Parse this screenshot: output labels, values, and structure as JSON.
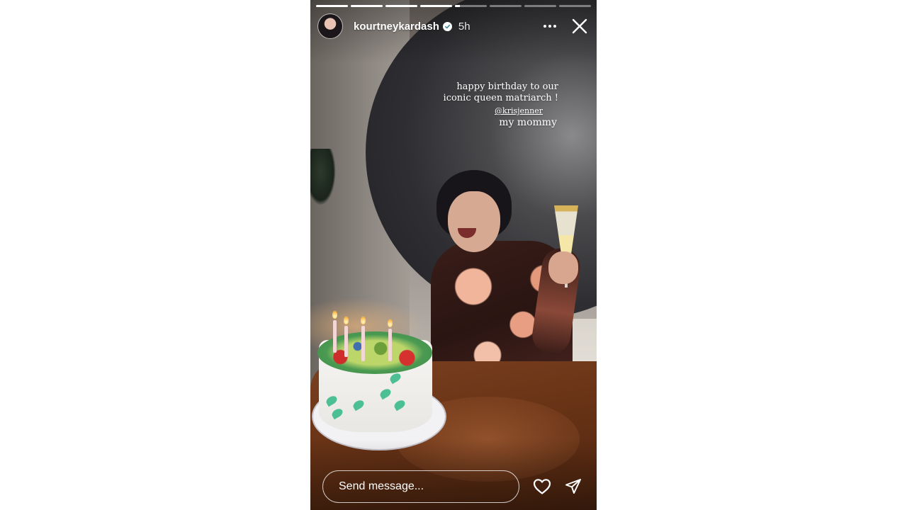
{
  "story": {
    "progress": {
      "segment_count": 8,
      "segment_fill": [
        1,
        1,
        1,
        1,
        0.15,
        0,
        0,
        0
      ]
    },
    "header": {
      "username": "kourtneykardash",
      "verified_icon": "verified-badge-icon",
      "time": "5h",
      "more_icon": "more-horizontal-icon",
      "close_icon": "close-icon"
    },
    "caption": {
      "line1": "happy birthday to our",
      "line2": "iconic queen matriarch !",
      "mention": "@krisjenner",
      "sign": "my mommy"
    },
    "footer": {
      "message_placeholder": "Send message...",
      "like_icon": "heart-icon",
      "share_icon": "send-icon"
    },
    "colors": {
      "ui_text": "#ffffff",
      "page_background": "#ffffff"
    }
  }
}
